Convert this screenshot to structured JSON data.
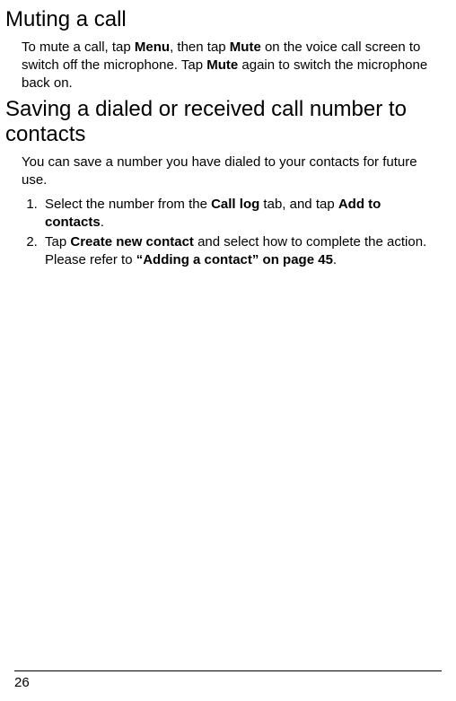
{
  "section1": {
    "heading": "Muting a call",
    "p1_part1": "To mute a call, tap ",
    "p1_bold1": "Menu",
    "p1_part2": ", then tap ",
    "p1_bold2": "Mute",
    "p1_part3": " on the voice call screen to switch off the microphone. Tap ",
    "p1_bold3": "Mute",
    "p1_part4": " again to switch the microphone back on."
  },
  "section2": {
    "heading": "Saving a dialed or received call number to contacts",
    "p1": "You can save a number you have dialed to your contacts for future use.",
    "li1_part1": "Select the number from the ",
    "li1_bold1": "Call log",
    "li1_part2": " tab, and tap ",
    "li1_bold2": "Add to contacts",
    "li1_part3": ".",
    "li2_part1": "Tap ",
    "li2_bold1": "Create new contact",
    "li2_part2": " and select how to complete the action. Please refer to ",
    "li2_xref": "“Adding a contact” on page 45",
    "li2_part3": "."
  },
  "page_number": "26"
}
